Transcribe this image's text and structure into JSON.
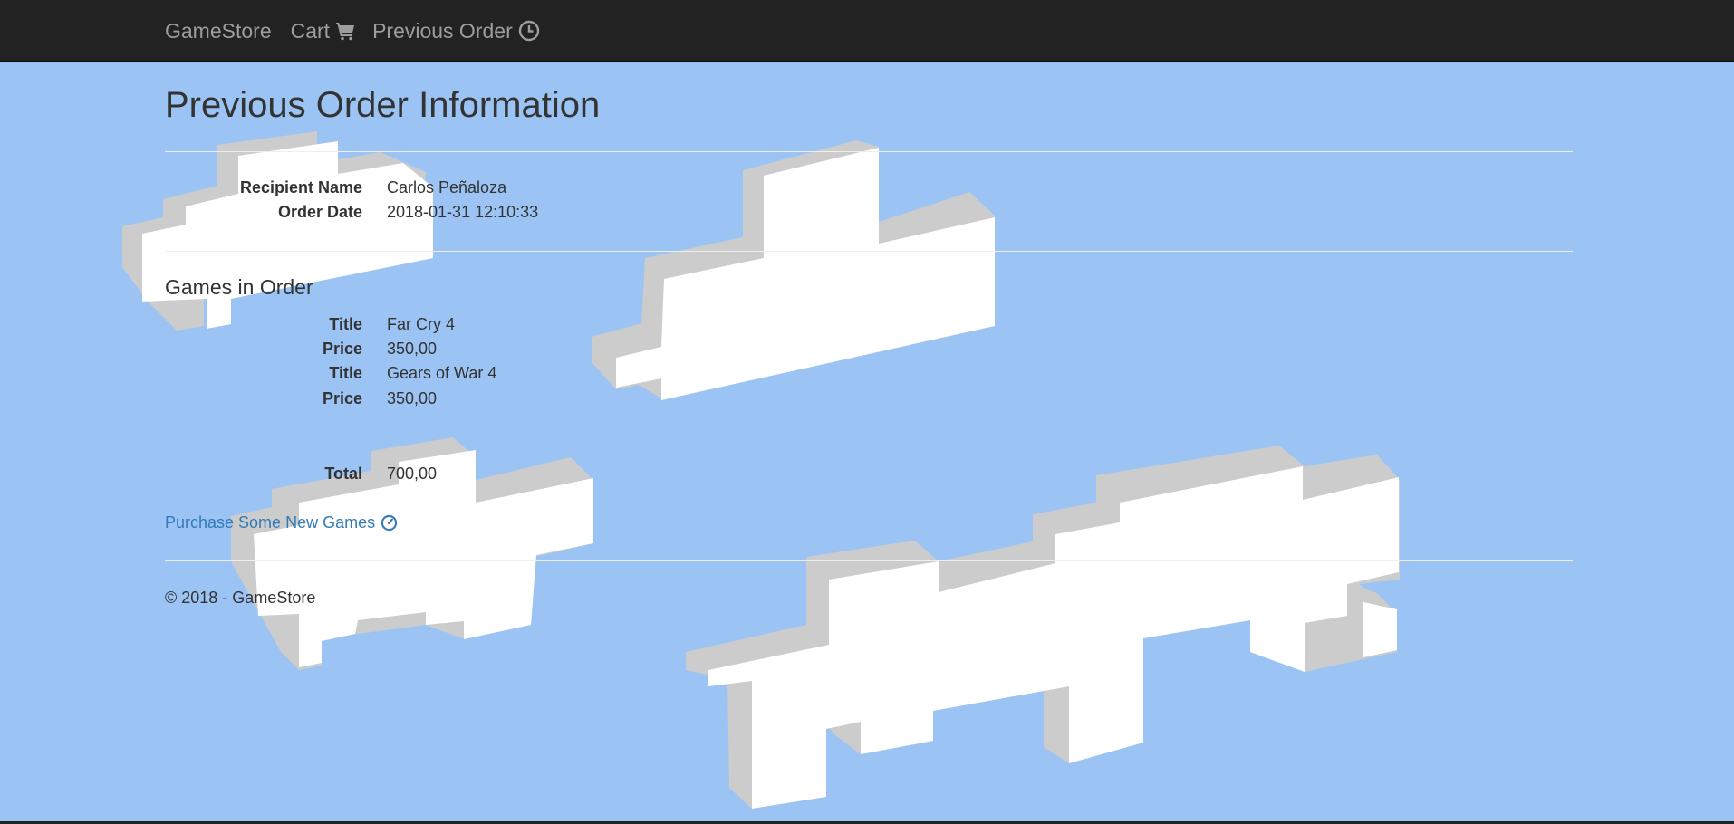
{
  "navbar": {
    "brand": "GameStore",
    "cart_label": "Cart",
    "previous_order_label": "Previous Order",
    "cart_icon": "shopping-cart-icon",
    "previous_order_icon": "clock-icon"
  },
  "page": {
    "title": "Previous Order Information"
  },
  "order": {
    "recipient_label": "Recipient Name",
    "recipient_value": "Carlos Peñaloza",
    "date_label": "Order Date",
    "date_value": "2018-01-31 12:10:33"
  },
  "games_section": {
    "heading": "Games in Order",
    "items": [
      {
        "title_label": "Title",
        "title": "Far Cry 4",
        "price_label": "Price",
        "price": "350,00"
      },
      {
        "title_label": "Title",
        "title": "Gears of War 4",
        "price_label": "Price",
        "price": "350,00"
      }
    ]
  },
  "total": {
    "label": "Total",
    "value": "700,00"
  },
  "purchase_link": {
    "label": "Purchase Some New Games",
    "icon": "dashboard-icon"
  },
  "footer": {
    "text": "© 2018 - GameStore"
  },
  "colors": {
    "sky_background": "#9bc4f5",
    "navbar": "#222222",
    "nav_text": "#9d9d9d",
    "link": "#337ab7",
    "cloud_top": "#ffffff",
    "cloud_side": "#cccccc"
  }
}
